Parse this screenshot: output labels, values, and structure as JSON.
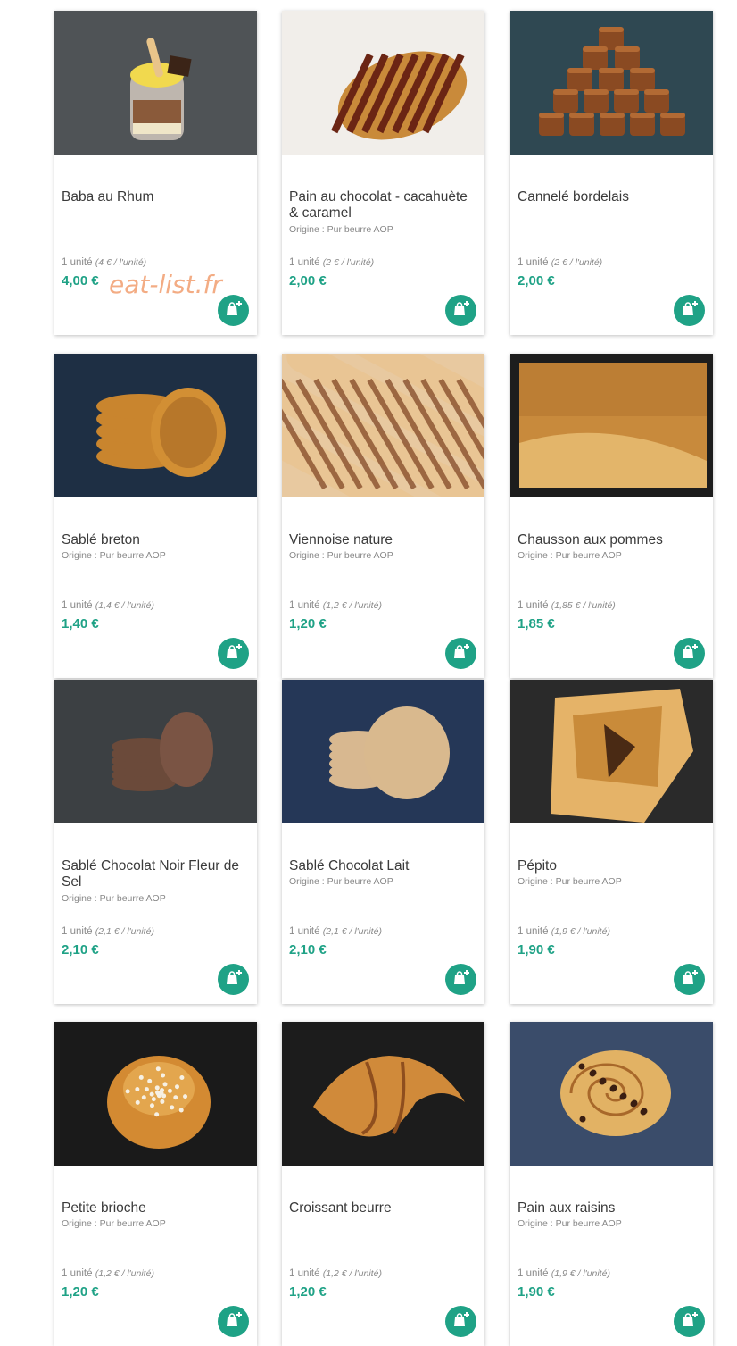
{
  "watermark": "eat-list.fr",
  "colors": {
    "accent": "#1fa286",
    "card_bg": "#ffffff",
    "watermark": "#f2a57a"
  },
  "add_button_icon": "bag-plus-icon",
  "products": [
    {
      "name": "Baba au Rhum",
      "origin": "",
      "unit_label": "1 unité",
      "unit_price": "(4 € / l'unité)",
      "price": "4,00 €",
      "photo_bg": "#4f5356"
    },
    {
      "name": "Pain au chocolat - cacahuète & caramel",
      "origin": "Origine : Pur beurre AOP",
      "unit_label": "1 unité",
      "unit_price": "(2 € / l'unité)",
      "price": "2,00 €",
      "photo_bg": "#f1eeea"
    },
    {
      "name": "Cannelé bordelais",
      "origin": "",
      "unit_label": "1 unité",
      "unit_price": "(2 € / l'unité)",
      "price": "2,00 €",
      "photo_bg": "#2f4852"
    },
    {
      "name": "Sablé breton",
      "origin": "Origine : Pur beurre AOP",
      "unit_label": "1 unité",
      "unit_price": "(1,4 € / l'unité)",
      "price": "1,40 €",
      "photo_bg": "#1e2f44"
    },
    {
      "name": "Viennoise nature",
      "origin": "Origine : Pur beurre AOP",
      "unit_label": "1 unité",
      "unit_price": "(1,2 € / l'unité)",
      "price": "1,20 €",
      "photo_bg": "#e8c9a0"
    },
    {
      "name": "Chausson aux pommes",
      "origin": "Origine : Pur beurre AOP",
      "unit_label": "1 unité",
      "unit_price": "(1,85 € / l'unité)",
      "price": "1,85 €",
      "photo_bg": "#1d1d1d"
    },
    {
      "name": "Sablé Chocolat Noir Fleur de Sel",
      "origin": "Origine : Pur beurre AOP",
      "unit_label": "1 unité",
      "unit_price": "(2,1 € / l'unité)",
      "price": "2,10 €",
      "photo_bg": "#3c4043"
    },
    {
      "name": "Sablé Chocolat Lait",
      "origin": "Origine : Pur beurre AOP",
      "unit_label": "1 unité",
      "unit_price": "(2,1 € / l'unité)",
      "price": "2,10 €",
      "photo_bg": "#253757"
    },
    {
      "name": "Pépito",
      "origin": "Origine : Pur beurre AOP",
      "unit_label": "1 unité",
      "unit_price": "(1,9 € / l'unité)",
      "price": "1,90 €",
      "photo_bg": "#2a2a2a"
    },
    {
      "name": "Petite brioche",
      "origin": "Origine : Pur beurre AOP",
      "unit_label": "1 unité",
      "unit_price": "(1,2 € / l'unité)",
      "price": "1,20 €",
      "photo_bg": "#1a1a1a"
    },
    {
      "name": "Croissant beurre",
      "origin": "",
      "unit_label": "1 unité",
      "unit_price": "(1,2 € / l'unité)",
      "price": "1,20 €",
      "photo_bg": "#1c1c1c"
    },
    {
      "name": "Pain aux raisins",
      "origin": "Origine : Pur beurre AOP",
      "unit_label": "1 unité",
      "unit_price": "(1,9 € / l'unité)",
      "price": "1,90 €",
      "photo_bg": "#3a4c6a"
    }
  ]
}
